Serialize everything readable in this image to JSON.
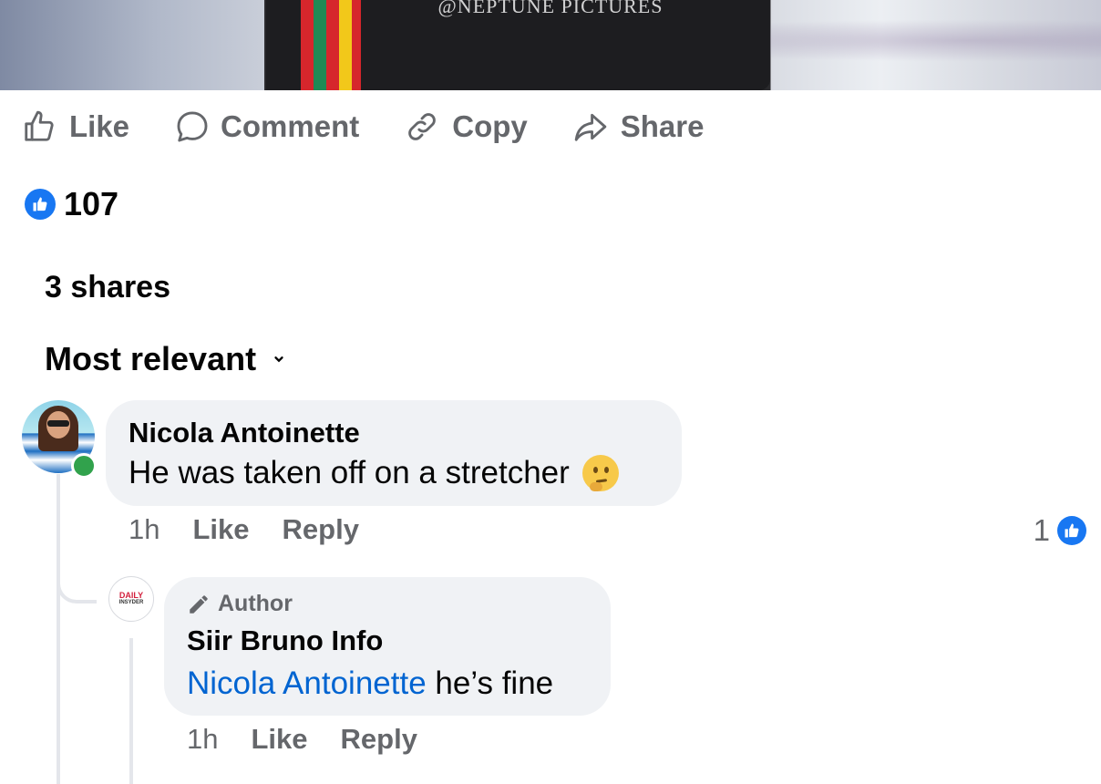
{
  "photo": {
    "watermark": "@NEPTUNE PICTURES"
  },
  "actions": [
    {
      "label": "Like",
      "icon": "thumbs-up-icon"
    },
    {
      "label": "Comment",
      "icon": "comment-icon"
    },
    {
      "label": "Copy",
      "icon": "link-icon"
    },
    {
      "label": "Share",
      "icon": "share-icon"
    }
  ],
  "reactions": {
    "count": "107",
    "icon": "like-reaction-icon",
    "color": "#1877f2"
  },
  "shares": "3 shares",
  "sort": {
    "label": "Most relevant",
    "icon": "chevron-down-icon"
  },
  "comments": [
    {
      "author": "Nicola Antoinette",
      "text": "He was taken off on a stretcher",
      "emoji": "thinking-face",
      "time": "1h",
      "like_label": "Like",
      "reply_label": "Reply",
      "reaction_count": "1",
      "online": true,
      "reply": {
        "badge": "Author",
        "author": "Siir Bruno Info",
        "avatar_text": [
          "DAILY",
          "INSYDER"
        ],
        "mention": "Nicola Antoinette",
        "text": " he’s fine",
        "time": "1h",
        "like_label": "Like",
        "reply_label": "Reply"
      }
    }
  ],
  "colors": {
    "accent": "#1877f2",
    "mention": "#0064d1",
    "muted": "#65676b",
    "bubble": "#f0f2f5",
    "online": "#31a24c"
  }
}
